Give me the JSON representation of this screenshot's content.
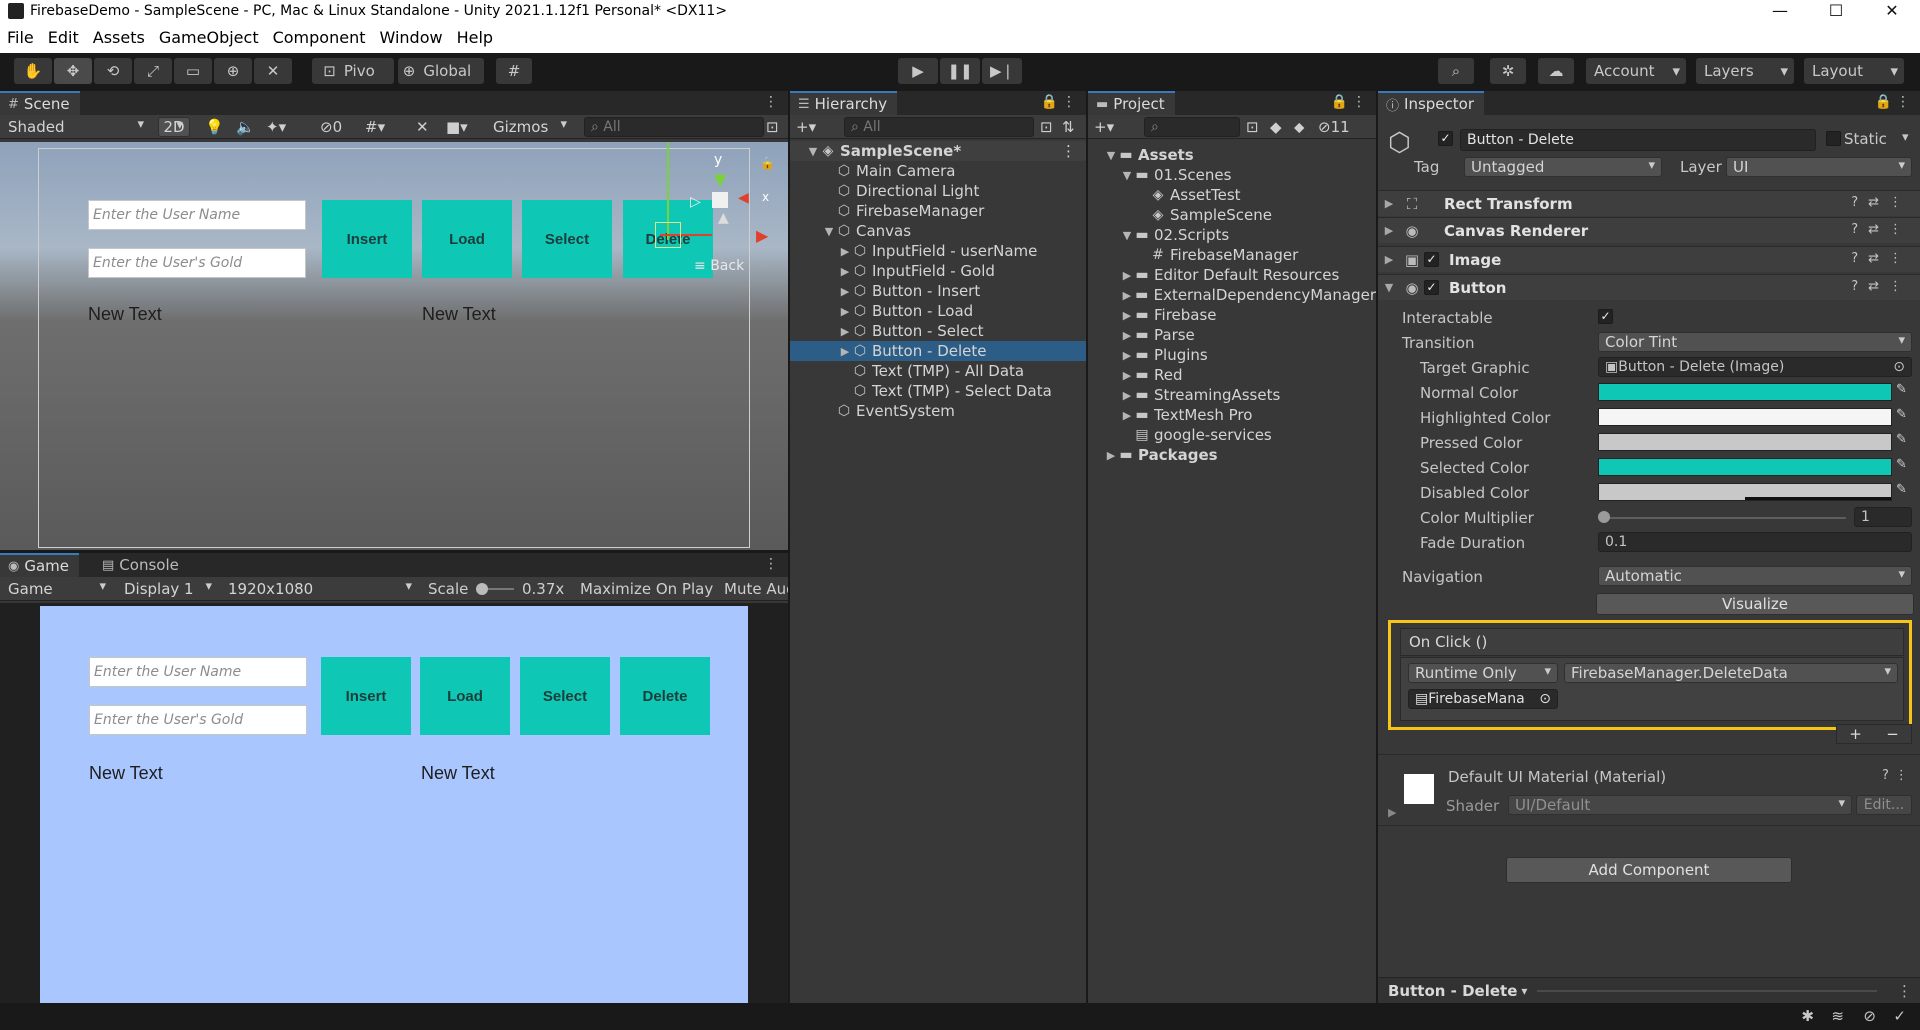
{
  "window": {
    "title": "FirebaseDemo - SampleScene - PC, Mac & Linux Standalone - Unity 2021.1.12f1 Personal* <DX11>",
    "controls": [
      "—",
      "☐",
      "✕"
    ]
  },
  "menu": [
    "File",
    "Edit",
    "Assets",
    "GameObject",
    "Component",
    "Window",
    "Help"
  ],
  "toolbar": {
    "pivot": "Pivo",
    "global": "Global",
    "account": "Account",
    "layers": "Layers",
    "layout": "Layout"
  },
  "scene": {
    "tab": "Scene",
    "shading": "Shaded",
    "mode2d": "2D",
    "hidden_count": "0",
    "gizmos": "Gizmos",
    "search_placeholder": "All",
    "gizmo_x": "x",
    "gizmo_y": "y",
    "back_label": "Back"
  },
  "ui": {
    "username_placeholder": "Enter the User Name",
    "gold_placeholder": "Enter the User's Gold",
    "insert": "Insert",
    "load": "Load",
    "select": "Select",
    "delete": "Delete",
    "text1": "New Text",
    "text2": "New Text"
  },
  "game": {
    "tab_game": "Game",
    "tab_console": "Console",
    "view_mode": "Game",
    "display": "Display 1",
    "resolution": "1920x1080",
    "scale_label": "Scale",
    "scale_value": "0.37x",
    "maximize": "Maximize On Play",
    "mute": "Mute Audio"
  },
  "hierarchy": {
    "tab": "Hierarchy",
    "search_placeholder": "All",
    "items": [
      {
        "label": "SampleScene*",
        "depth": 0,
        "arrow": "▼",
        "icon": "◈",
        "bold": true
      },
      {
        "label": "Main Camera",
        "depth": 1,
        "arrow": "",
        "icon": "⬡"
      },
      {
        "label": "Directional Light",
        "depth": 1,
        "arrow": "",
        "icon": "⬡"
      },
      {
        "label": "FirebaseManager",
        "depth": 1,
        "arrow": "",
        "icon": "⬡"
      },
      {
        "label": "Canvas",
        "depth": 1,
        "arrow": "▼",
        "icon": "⬡"
      },
      {
        "label": "InputField - userName",
        "depth": 2,
        "arrow": "▶",
        "icon": "⬡"
      },
      {
        "label": "InputField - Gold",
        "depth": 2,
        "arrow": "▶",
        "icon": "⬡"
      },
      {
        "label": "Button - Insert",
        "depth": 2,
        "arrow": "▶",
        "icon": "⬡"
      },
      {
        "label": "Button - Load",
        "depth": 2,
        "arrow": "▶",
        "icon": "⬡"
      },
      {
        "label": "Button - Select",
        "depth": 2,
        "arrow": "▶",
        "icon": "⬡"
      },
      {
        "label": "Button - Delete",
        "depth": 2,
        "arrow": "▶",
        "icon": "⬡",
        "selected": true
      },
      {
        "label": "Text (TMP) - All Data",
        "depth": 2,
        "arrow": "",
        "icon": "⬡"
      },
      {
        "label": "Text (TMP) - Select Data",
        "depth": 2,
        "arrow": "",
        "icon": "⬡"
      },
      {
        "label": "EventSystem",
        "depth": 1,
        "arrow": "",
        "icon": "⬡"
      }
    ]
  },
  "project": {
    "tab": "Project",
    "hidden_count": "11",
    "items": [
      {
        "label": "Assets",
        "depth": 0,
        "arrow": "▼",
        "icon": "folder",
        "bold": true
      },
      {
        "label": "01.Scenes",
        "depth": 1,
        "arrow": "▼",
        "icon": "folder"
      },
      {
        "label": "AssetTest",
        "depth": 2,
        "arrow": "",
        "icon": "scene"
      },
      {
        "label": "SampleScene",
        "depth": 2,
        "arrow": "",
        "icon": "scene"
      },
      {
        "label": "02.Scripts",
        "depth": 1,
        "arrow": "▼",
        "icon": "folder"
      },
      {
        "label": "FirebaseManager",
        "depth": 2,
        "arrow": "",
        "icon": "script"
      },
      {
        "label": "Editor Default Resources",
        "depth": 1,
        "arrow": "▶",
        "icon": "folder"
      },
      {
        "label": "ExternalDependencyManager",
        "depth": 1,
        "arrow": "▶",
        "icon": "folder"
      },
      {
        "label": "Firebase",
        "depth": 1,
        "arrow": "▶",
        "icon": "folder"
      },
      {
        "label": "Parse",
        "depth": 1,
        "arrow": "▶",
        "icon": "folder"
      },
      {
        "label": "Plugins",
        "depth": 1,
        "arrow": "▶",
        "icon": "folder"
      },
      {
        "label": "Red",
        "depth": 1,
        "arrow": "▶",
        "icon": "folder"
      },
      {
        "label": "StreamingAssets",
        "depth": 1,
        "arrow": "▶",
        "icon": "folder"
      },
      {
        "label": "TextMesh Pro",
        "depth": 1,
        "arrow": "▶",
        "icon": "folder"
      },
      {
        "label": "google-services",
        "depth": 1,
        "arrow": "",
        "icon": "file"
      },
      {
        "label": "Packages",
        "depth": 0,
        "arrow": "▶",
        "icon": "folder",
        "bold": true
      }
    ]
  },
  "inspector": {
    "tab": "Inspector",
    "object_name": "Button - Delete",
    "static_label": "Static",
    "tag_label": "Tag",
    "tag_value": "Untagged",
    "layer_label": "Layer",
    "layer_value": "UI",
    "components": {
      "rect": "Rect Transform",
      "canvas_renderer": "Canvas Renderer",
      "image": "Image",
      "button": "Button"
    },
    "button": {
      "interactable_label": "Interactable",
      "transition_label": "Transition",
      "transition_value": "Color Tint",
      "target_graphic_label": "Target Graphic",
      "target_graphic_value": "Button - Delete (Image)",
      "normal_label": "Normal Color",
      "highlighted_label": "Highlighted Color",
      "pressed_label": "Pressed Color",
      "selected_label": "Selected Color",
      "disabled_label": "Disabled Color",
      "multiplier_label": "Color Multiplier",
      "multiplier_value": "1",
      "multiplier_fraction": 0,
      "fade_label": "Fade Duration",
      "fade_value": "0.1",
      "navigation_label": "Navigation",
      "navigation_value": "Automatic",
      "visualize": "Visualize"
    },
    "colors": {
      "normal": "#0ec8b5",
      "highlighted": "#f5f5f5",
      "pressed": "#c8c8c8",
      "selected": "#0ec8b5",
      "disabled": "#c8c8c8",
      "highlight_box": "#f5c518"
    },
    "onclick": {
      "title": "On Click ()",
      "runtime": "Runtime Only",
      "function": "FirebaseManager.DeleteData",
      "object": "FirebaseMana",
      "add": "+",
      "remove": "−"
    },
    "material": {
      "name": "Default UI Material (Material)",
      "shader_label": "Shader",
      "shader_value": "UI/Default",
      "edit": "Edit..."
    },
    "add_component": "Add Component",
    "footer": "Button - Delete"
  }
}
